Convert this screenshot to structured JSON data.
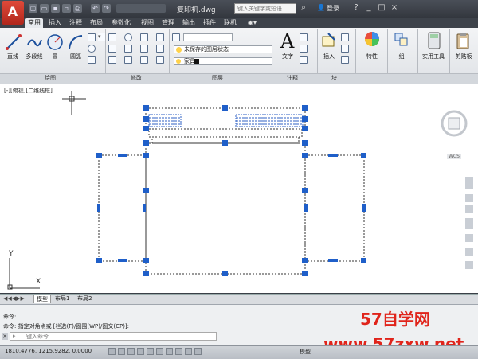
{
  "app": {
    "logo_letter": "A",
    "title": "复印机.dwg",
    "search_placeholder": "键入关键字或短语",
    "login": "登录"
  },
  "tabs": [
    "常用",
    "插入",
    "注释",
    "布局",
    "参数化",
    "视图",
    "管理",
    "输出",
    "插件",
    "联机"
  ],
  "ribbon": {
    "draw_tools": [
      "直线",
      "多段线",
      "圆",
      "圆弧"
    ],
    "layer_state": "未保存的图层状态",
    "layer_name": "家具",
    "text_tool": "文字",
    "insert_tool": "插入",
    "right_tools": [
      "特性",
      "组",
      "实用工具",
      "剪贴板"
    ],
    "groups": [
      "绘图",
      "修改",
      "图层",
      "注释",
      "块"
    ]
  },
  "viewport": {
    "label": "[-][俯视][二维线框]",
    "axis_y": "Y",
    "axis_x": "X",
    "wcs": "WCS"
  },
  "layout_tabs": [
    "模型",
    "布局1",
    "布局2"
  ],
  "command": {
    "line1": "命令:",
    "line2": "命令: 指定对角点或 [栏选(F)/圈围(WP)/圈交(CP)]:",
    "placeholder": "键入命令"
  },
  "status": {
    "coords": "1810.4776, 1215.9282, 0.0000",
    "model": "模型"
  },
  "watermark": {
    "line1": "57自学网",
    "line2": "www.57zxw.net"
  },
  "colors": {
    "accent": "#e0241b",
    "grip": "#1f5fc9"
  }
}
